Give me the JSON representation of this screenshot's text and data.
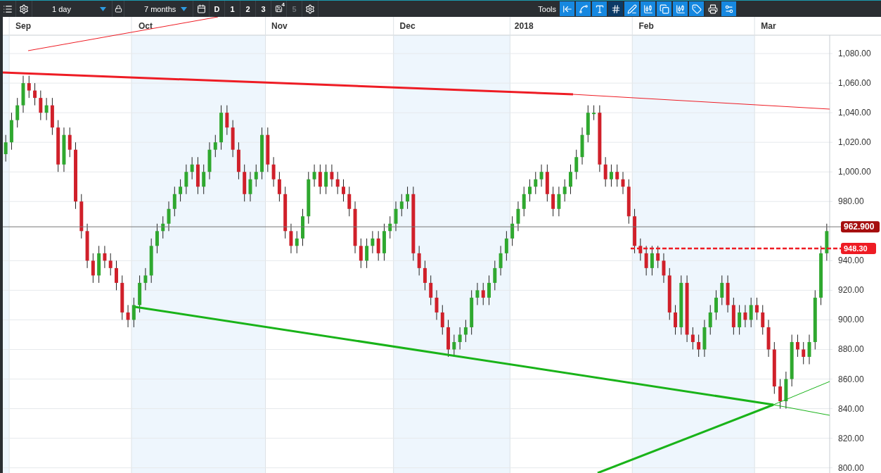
{
  "toolbar": {
    "interval": "1 day",
    "range": "7 months",
    "layouts": [
      {
        "label": "D",
        "kind": "plain",
        "disabled": false
      },
      {
        "label": "1",
        "kind": "plain",
        "disabled": false
      },
      {
        "label": "2",
        "kind": "plain",
        "disabled": false
      },
      {
        "label": "3",
        "kind": "plain",
        "disabled": false
      },
      {
        "label": "4",
        "kind": "save",
        "disabled": false
      },
      {
        "label": "5",
        "kind": "plain",
        "disabled": true
      }
    ],
    "tools_label": "Tools",
    "tools": [
      {
        "kind": "toggle",
        "selected": false
      },
      {
        "kind": "toggle",
        "selected": false
      },
      {
        "kind": "toggle",
        "selected": false
      },
      {
        "kind": "toggle",
        "selected": true
      },
      {
        "kind": "toggle",
        "selected": false
      },
      {
        "kind": "toggle",
        "selected": false
      },
      {
        "kind": "toggle",
        "selected": false
      },
      {
        "kind": "toggle",
        "selected": false
      },
      {
        "kind": "toggle",
        "selected": false
      },
      {
        "kind": "action",
        "selected": false
      },
      {
        "kind": "toggle",
        "selected": false
      }
    ]
  },
  "chart": {
    "chart_data": {
      "type": "candlestick",
      "grid": true,
      "ylim": [
        796.5,
        1092.4
      ],
      "yticks": [
        {
          "value": 1080,
          "label": "1,080.00"
        },
        {
          "value": 1060,
          "label": "1,060.00"
        },
        {
          "value": 1040,
          "label": "1,040.00"
        },
        {
          "value": 1020,
          "label": "1,020.00"
        },
        {
          "value": 1000,
          "label": "1,000.00"
        },
        {
          "value": 980,
          "label": "980.00"
        },
        {
          "value": 940,
          "label": "940.00"
        },
        {
          "value": 920,
          "label": "920.00"
        },
        {
          "value": 900,
          "label": "900.00"
        },
        {
          "value": 880,
          "label": "880.00"
        },
        {
          "value": 860,
          "label": "860.00"
        },
        {
          "value": 840,
          "label": "840.00"
        },
        {
          "value": 820,
          "label": "820.00"
        },
        {
          "value": 800,
          "label": "800.00"
        }
      ],
      "categories": [
        null,
        null,
        null,
        "Sep",
        null,
        null,
        null,
        null,
        null,
        null,
        null,
        null,
        null,
        null,
        null,
        null,
        null,
        null,
        null,
        null,
        null,
        null,
        null,
        null,
        "Oct",
        null,
        null,
        null,
        null,
        null,
        null,
        null,
        null,
        null,
        null,
        null,
        null,
        null,
        null,
        null,
        null,
        null,
        null,
        null,
        null,
        null,
        null,
        "Nov",
        null,
        null,
        null,
        null,
        null,
        null,
        null,
        null,
        null,
        null,
        null,
        null,
        null,
        null,
        null,
        null,
        null,
        null,
        null,
        null,
        null,
        "Dec",
        null,
        null,
        null,
        null,
        null,
        null,
        null,
        null,
        null,
        null,
        null,
        null,
        null,
        null,
        null,
        null,
        null,
        null,
        null,
        "2018",
        null,
        null,
        null,
        null,
        null,
        null,
        null,
        null,
        null,
        null,
        null,
        null,
        null,
        null,
        null,
        null,
        null,
        null,
        null,
        null,
        "Feb",
        null,
        null,
        null,
        null,
        null,
        null,
        null,
        null,
        null,
        null,
        null,
        null,
        null,
        null,
        null,
        null,
        null,
        null,
        null,
        null,
        "Mar",
        null,
        null,
        null,
        null,
        null,
        null,
        null,
        null,
        null,
        null
      ],
      "ohlc": [
        [
          1012,
          1025,
          1007,
          1020
        ],
        [
          1020,
          1040,
          1015,
          1035
        ],
        [
          1035,
          1050,
          1030,
          1045
        ],
        [
          1045,
          1065,
          1040,
          1060
        ],
        [
          1060,
          1065,
          1050,
          1055
        ],
        [
          1055,
          1060,
          1045,
          1050
        ],
        [
          1050,
          1055,
          1035,
          1040
        ],
        [
          1040,
          1050,
          1035,
          1045
        ],
        [
          1045,
          1050,
          1025,
          1030
        ],
        [
          1030,
          1035,
          1000,
          1005
        ],
        [
          1005,
          1030,
          1000,
          1025
        ],
        [
          1025,
          1030,
          1010,
          1015
        ],
        [
          1015,
          1020,
          975,
          980
        ],
        [
          980,
          985,
          955,
          960
        ],
        [
          960,
          965,
          935,
          940
        ],
        [
          940,
          945,
          925,
          930
        ],
        [
          930,
          950,
          925,
          945
        ],
        [
          945,
          950,
          935,
          940
        ],
        [
          940,
          945,
          930,
          935
        ],
        [
          935,
          940,
          920,
          925
        ],
        [
          925,
          930,
          900,
          905
        ],
        [
          905,
          910,
          895,
          900
        ],
        [
          900,
          915,
          895,
          910
        ],
        [
          910,
          930,
          905,
          925
        ],
        [
          925,
          935,
          920,
          930
        ],
        [
          930,
          955,
          925,
          950
        ],
        [
          950,
          965,
          945,
          960
        ],
        [
          960,
          970,
          955,
          965
        ],
        [
          965,
          980,
          960,
          975
        ],
        [
          975,
          990,
          970,
          985
        ],
        [
          985,
          995,
          980,
          990
        ],
        [
          990,
          1005,
          985,
          1000
        ],
        [
          1000,
          1010,
          995,
          1005
        ],
        [
          1005,
          1010,
          985,
          990
        ],
        [
          990,
          1005,
          985,
          1000
        ],
        [
          1000,
          1020,
          995,
          1015
        ],
        [
          1015,
          1025,
          1010,
          1020
        ],
        [
          1020,
          1045,
          1015,
          1040
        ],
        [
          1040,
          1045,
          1025,
          1030
        ],
        [
          1030,
          1035,
          1010,
          1015
        ],
        [
          1015,
          1020,
          995,
          1000
        ],
        [
          1000,
          1005,
          980,
          985
        ],
        [
          985,
          1000,
          980,
          995
        ],
        [
          995,
          1005,
          990,
          1000
        ],
        [
          1000,
          1030,
          995,
          1025
        ],
        [
          1025,
          1030,
          1000,
          1005
        ],
        [
          1005,
          1010,
          990,
          995
        ],
        [
          995,
          1000,
          980,
          985
        ],
        [
          985,
          990,
          955,
          960
        ],
        [
          960,
          965,
          945,
          950
        ],
        [
          950,
          960,
          945,
          955
        ],
        [
          955,
          975,
          950,
          970
        ],
        [
          970,
          1000,
          965,
          995
        ],
        [
          995,
          1005,
          990,
          1000
        ],
        [
          1000,
          1005,
          985,
          990
        ],
        [
          990,
          1005,
          985,
          1000
        ],
        [
          1000,
          1005,
          990,
          995
        ],
        [
          995,
          1000,
          985,
          990
        ],
        [
          990,
          995,
          980,
          985
        ],
        [
          985,
          990,
          970,
          975
        ],
        [
          975,
          980,
          945,
          950
        ],
        [
          950,
          955,
          935,
          940
        ],
        [
          940,
          955,
          935,
          950
        ],
        [
          950,
          960,
          945,
          955
        ],
        [
          955,
          960,
          940,
          945
        ],
        [
          945,
          965,
          940,
          960
        ],
        [
          960,
          970,
          955,
          965
        ],
        [
          965,
          980,
          960,
          975
        ],
        [
          975,
          985,
          970,
          980
        ],
        [
          980,
          990,
          975,
          985
        ],
        [
          985,
          990,
          940,
          945
        ],
        [
          945,
          950,
          930,
          935
        ],
        [
          935,
          940,
          920,
          925
        ],
        [
          925,
          930,
          910,
          915
        ],
        [
          915,
          920,
          900,
          905
        ],
        [
          905,
          910,
          890,
          895
        ],
        [
          895,
          900,
          875,
          880
        ],
        [
          880,
          890,
          875,
          885
        ],
        [
          885,
          895,
          880,
          890
        ],
        [
          890,
          900,
          885,
          895
        ],
        [
          895,
          920,
          890,
          915
        ],
        [
          915,
          925,
          910,
          920
        ],
        [
          920,
          925,
          910,
          915
        ],
        [
          915,
          930,
          910,
          925
        ],
        [
          925,
          940,
          920,
          935
        ],
        [
          935,
          950,
          930,
          945
        ],
        [
          945,
          960,
          940,
          955
        ],
        [
          955,
          970,
          950,
          965
        ],
        [
          965,
          980,
          960,
          975
        ],
        [
          975,
          990,
          970,
          985
        ],
        [
          985,
          995,
          980,
          990
        ],
        [
          990,
          1000,
          985,
          995
        ],
        [
          995,
          1005,
          990,
          1000
        ],
        [
          1000,
          1005,
          980,
          985
        ],
        [
          985,
          990,
          970,
          975
        ],
        [
          975,
          990,
          970,
          985
        ],
        [
          985,
          995,
          980,
          990
        ],
        [
          990,
          1005,
          985,
          1000
        ],
        [
          1000,
          1015,
          995,
          1010
        ],
        [
          1010,
          1030,
          1005,
          1025
        ],
        [
          1025,
          1045,
          1020,
          1040
        ],
        [
          1040,
          1045,
          1035,
          1040
        ],
        [
          1040,
          1045,
          1000,
          1005
        ],
        [
          1005,
          1010,
          990,
          995
        ],
        [
          995,
          1005,
          990,
          1000
        ],
        [
          1000,
          1005,
          990,
          995
        ],
        [
          995,
          1000,
          985,
          990
        ],
        [
          990,
          995,
          965,
          970
        ],
        [
          970,
          975,
          945,
          950
        ],
        [
          950,
          955,
          940,
          945
        ],
        [
          945,
          950,
          930,
          935
        ],
        [
          935,
          950,
          930,
          945
        ],
        [
          945,
          950,
          935,
          940
        ],
        [
          940,
          945,
          925,
          930
        ],
        [
          930,
          935,
          900,
          905
        ],
        [
          905,
          910,
          890,
          895
        ],
        [
          895,
          930,
          890,
          925
        ],
        [
          925,
          930,
          885,
          890
        ],
        [
          890,
          895,
          880,
          885
        ],
        [
          885,
          890,
          875,
          880
        ],
        [
          880,
          900,
          875,
          895
        ],
        [
          895,
          910,
          890,
          905
        ],
        [
          905,
          920,
          900,
          915
        ],
        [
          915,
          930,
          910,
          925
        ],
        [
          925,
          930,
          905,
          910
        ],
        [
          910,
          915,
          890,
          895
        ],
        [
          895,
          910,
          890,
          905
        ],
        [
          905,
          910,
          895,
          900
        ],
        [
          900,
          915,
          895,
          910
        ],
        [
          910,
          915,
          900,
          905
        ],
        [
          905,
          910,
          890,
          895
        ],
        [
          895,
          900,
          875,
          880
        ],
        [
          880,
          885,
          850,
          855
        ],
        [
          855,
          860,
          840,
          845
        ],
        [
          845,
          865,
          840,
          860
        ],
        [
          860,
          890,
          855,
          885
        ],
        [
          885,
          890,
          875,
          880
        ],
        [
          880,
          885,
          870,
          875
        ],
        [
          875,
          890,
          870,
          885
        ],
        [
          885,
          920,
          880,
          915
        ],
        [
          915,
          950,
          910,
          945
        ],
        [
          945,
          965,
          940,
          960
        ]
      ]
    },
    "price_tags": [
      {
        "label": "962.900",
        "color": "#a50d0d"
      },
      {
        "label": "948.30",
        "color": "#ee1c24"
      }
    ]
  }
}
